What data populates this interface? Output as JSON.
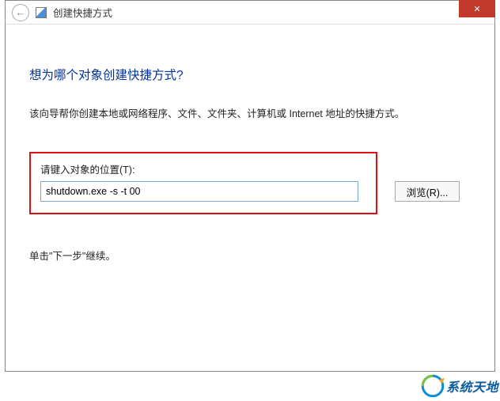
{
  "titlebar": {
    "title": "创建快捷方式"
  },
  "content": {
    "heading": "想为哪个对象创建快捷方式?",
    "description": "该向导帮你创建本地或网络程序、文件、文件夹、计算机或 Internet 地址的快捷方式。",
    "field_label": "请键入对象的位置(T):",
    "path_value": "shutdown.exe -s -t 00",
    "browse_label": "浏览(R)...",
    "continue_text": "单击\"下一步\"继续。"
  },
  "watermark": {
    "text": "系统天地"
  }
}
